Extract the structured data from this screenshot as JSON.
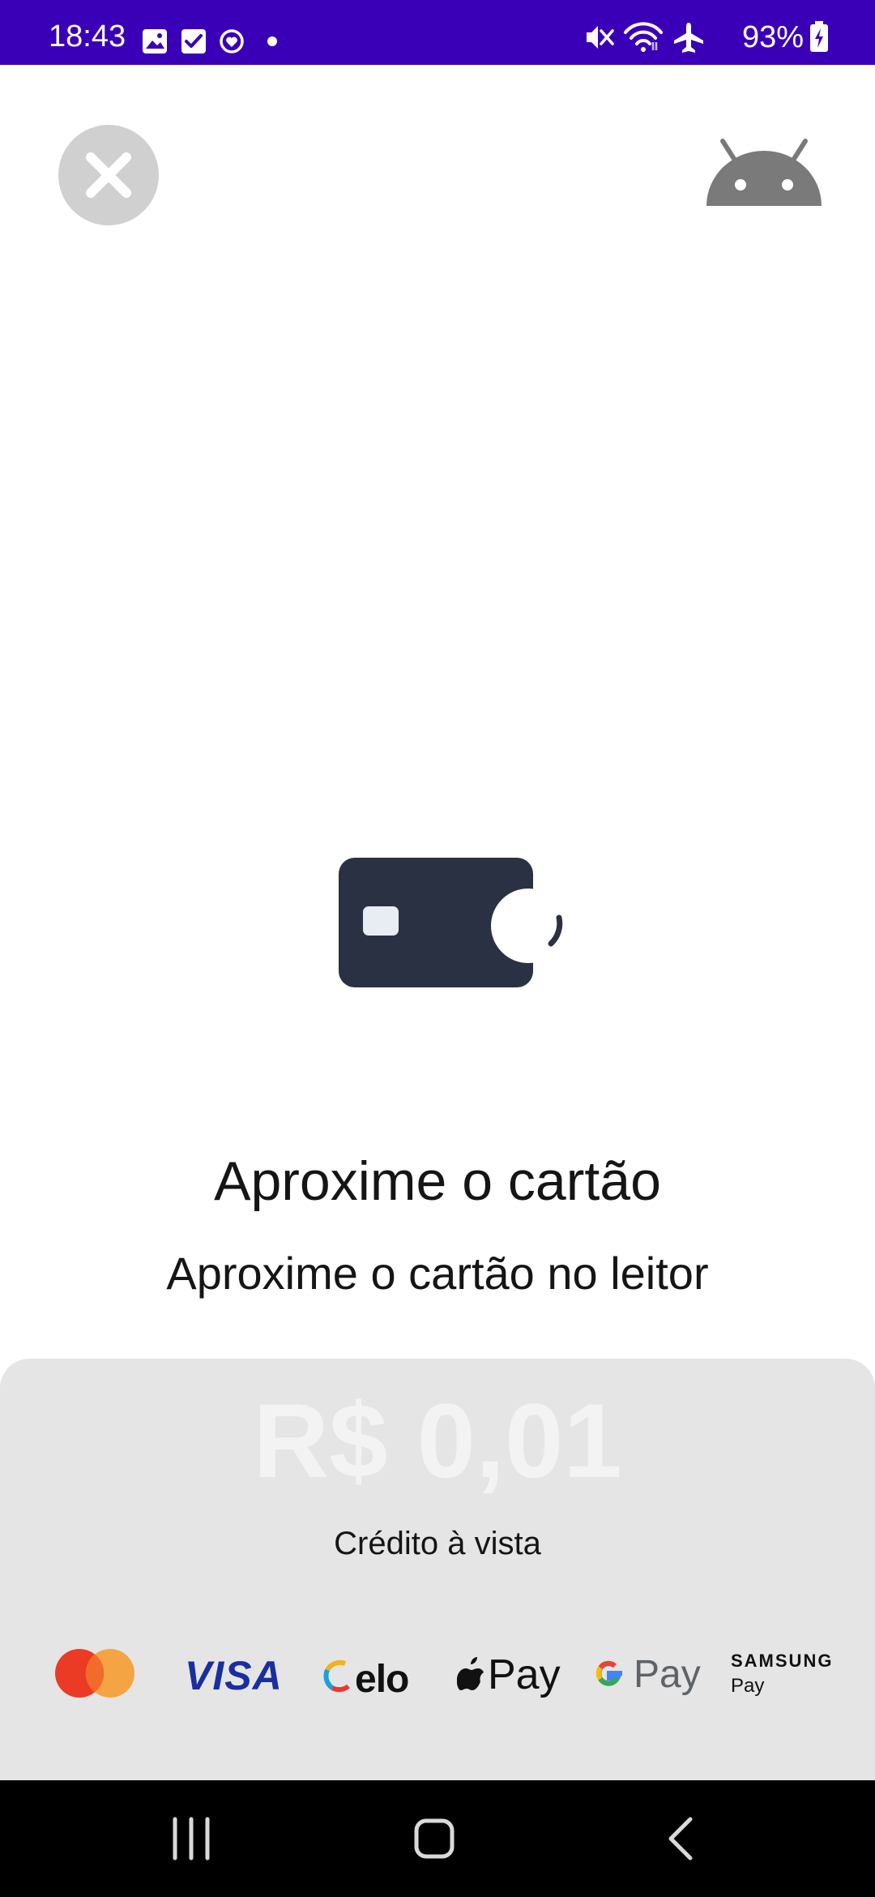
{
  "status_bar": {
    "time": "18:43",
    "battery_percent": "93%",
    "background_color": "#3a00b8",
    "icons_left": [
      "gallery-icon",
      "checkbox-icon",
      "refresh-heart-icon",
      "dot-icon"
    ],
    "icons_right": [
      "mute-icon",
      "wifi-icon",
      "airplane-icon",
      "battery-charging-icon"
    ]
  },
  "header": {
    "close_icon": "close-icon",
    "logo_icon": "android-icon"
  },
  "prompt": {
    "title": "Aproxime o cartão",
    "subtitle": "Aproxime o cartão no leitor"
  },
  "payment": {
    "amount": "R$ 0,01",
    "type": "Crédito à vista",
    "brands": {
      "mastercard": "mastercard-logo",
      "visa": "VISA",
      "elo": "elo",
      "apple_pay": "Pay",
      "google_pay": "Pay",
      "samsung_pay_line1": "SAMSUNG",
      "samsung_pay_line2": "Pay"
    }
  },
  "nav_bar": {
    "buttons": [
      "recents-icon",
      "home-icon",
      "back-icon"
    ]
  }
}
